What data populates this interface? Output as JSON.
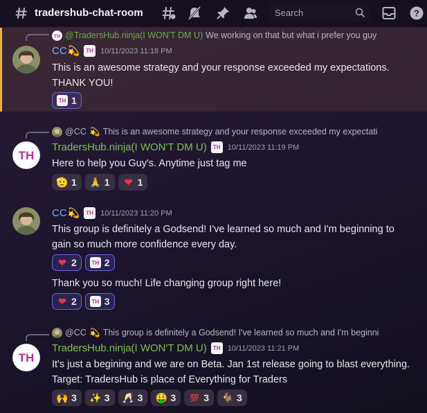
{
  "channel": {
    "name": "tradershub-chat-room"
  },
  "search": {
    "placeholder": "Search"
  },
  "messages": [
    {
      "reply": {
        "author": "@TradersHub.ninja(I WON'T DM U)",
        "text": "We working on that but what i prefer you guy"
      },
      "author": "CC",
      "timestamp": "10/11/2023 11:18 PM",
      "text": "This is an awesome strategy and your response exceeded my expectations. THANK YOU!",
      "reactions": [
        {
          "icon": "th-logo",
          "count": "1"
        }
      ]
    },
    {
      "reply": {
        "author": "@CC",
        "text": "This is an awesome strategy and your response exceeded my expectati"
      },
      "author": "TradersHub.ninja(I WON'T DM U)",
      "timestamp": "10/11/2023 11:19 PM",
      "text": "Here to help you Guy's. Anytime just tag me",
      "reactions": [
        {
          "icon": "face-emoji",
          "count": "1"
        },
        {
          "icon": "pray-emoji",
          "count": "1"
        },
        {
          "icon": "heart-emoji",
          "count": "1"
        }
      ]
    },
    {
      "author": "CC",
      "timestamp": "10/11/2023 11:20 PM",
      "text": "This group is definitely a Godsend! I've learned so much and I'm beginning to gain so much more confidence every day.",
      "reactions": [
        {
          "icon": "heart-emoji",
          "count": "2"
        },
        {
          "icon": "th-logo",
          "count": "2"
        }
      ],
      "followup": {
        "text": "Thank you so much! Life changing group right here!",
        "reactions": [
          {
            "icon": "heart-emoji",
            "count": "2"
          },
          {
            "icon": "th-logo",
            "count": "3"
          }
        ]
      }
    },
    {
      "reply": {
        "author": "@CC",
        "text": "This group is definitely a Godsend! I've learned so much and I'm beginni"
      },
      "author": "TradersHub.ninja(I WON'T DM U)",
      "timestamp": "10/11/2023 11:21 PM",
      "text": "It's just a begining and we are on Beta. Jan 1st release going to blast everything. Target: TradersHub is place of Everything for Traders",
      "reactions": [
        {
          "icon": "raised-hands-emoji",
          "count": "3"
        },
        {
          "icon": "sparkles-emoji",
          "count": "3"
        },
        {
          "icon": "cheers-emoji",
          "count": "3"
        },
        {
          "icon": "money-face-emoji",
          "count": "3"
        },
        {
          "icon": "hundred-emoji",
          "count": "3"
        },
        {
          "icon": "goat-emoji",
          "count": "3"
        }
      ]
    }
  ],
  "glyphs": {
    "sparkle": "💫",
    "th": "TH",
    "face": "🫡",
    "pray": "🙏",
    "heart": "❤",
    "raised_hands": "🙌",
    "sparkles": "✨",
    "cheers": "🥂",
    "money_face": "🤑",
    "hundred": "💯",
    "goat": "🐐"
  },
  "colors": {
    "accent_highlight": "#e8b04a",
    "cc_name": "#6fb0ff",
    "th_name": "#7cc34c",
    "brand": "#b0309a"
  }
}
